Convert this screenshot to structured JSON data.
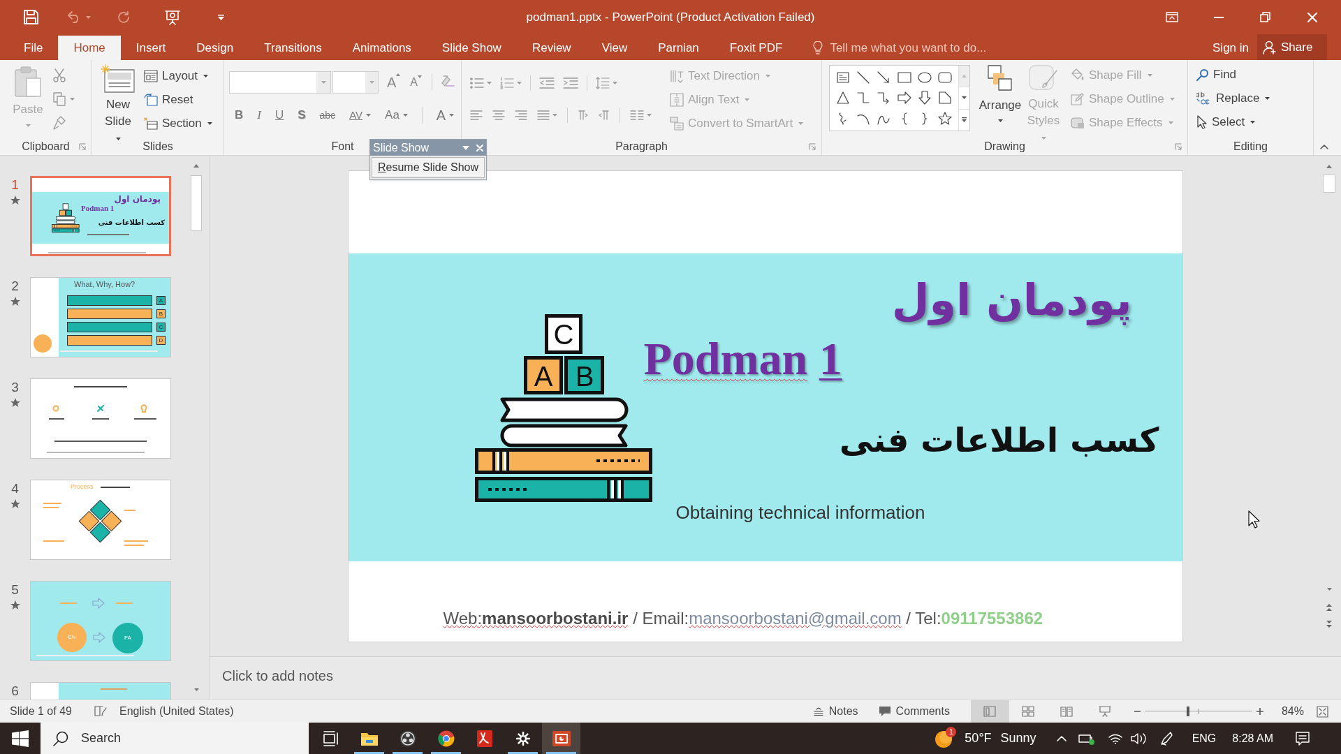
{
  "title_bar": {
    "title": "podman1.pptx - PowerPoint (Product Activation Failed)"
  },
  "ribbon_tabs": [
    {
      "label": "File",
      "selected": false
    },
    {
      "label": "Home",
      "selected": true
    },
    {
      "label": "Insert",
      "selected": false
    },
    {
      "label": "Design",
      "selected": false
    },
    {
      "label": "Transitions",
      "selected": false
    },
    {
      "label": "Animations",
      "selected": false
    },
    {
      "label": "Slide Show",
      "selected": false
    },
    {
      "label": "Review",
      "selected": false
    },
    {
      "label": "View",
      "selected": false
    },
    {
      "label": "Parnian",
      "selected": false
    },
    {
      "label": "Foxit PDF",
      "selected": false
    }
  ],
  "tell_me": {
    "placeholder": "Tell me what you want to do..."
  },
  "account": {
    "sign_in": "Sign in",
    "share": "Share"
  },
  "ribbon": {
    "clipboard": {
      "label": "Clipboard",
      "paste": {
        "label": "Paste",
        "disabled": true
      }
    },
    "slides": {
      "label": "Slides",
      "new_slide": {
        "label": "New Slide",
        "disabled": false
      },
      "commands": [
        {
          "label": "Layout",
          "dropdown": true,
          "disabled": false
        },
        {
          "label": "Reset",
          "dropdown": false,
          "disabled": false
        },
        {
          "label": "Section",
          "dropdown": true,
          "disabled": false
        }
      ]
    },
    "font": {
      "label": "Font",
      "size_buttons": [
        {
          "label": "A",
          "kind": "grow"
        },
        {
          "label": "A",
          "kind": "shrink"
        }
      ],
      "format_buttons": [
        {
          "label": "B",
          "kind": "bold"
        },
        {
          "label": "I",
          "kind": "italic"
        },
        {
          "label": "U",
          "kind": "underline"
        },
        {
          "label": "S",
          "kind": "shadow"
        },
        {
          "label": "abc",
          "kind": "strike"
        },
        {
          "label": "AV",
          "kind": "spacing"
        },
        {
          "label": "Aa",
          "kind": "case"
        },
        {
          "label": "A",
          "kind": "color"
        }
      ]
    },
    "paragraph": {
      "label": "Paragraph",
      "commands": [
        {
          "label": "Text Direction",
          "dropdown": true,
          "disabled": true
        },
        {
          "label": "Align Text",
          "dropdown": true,
          "disabled": true
        },
        {
          "label": "Convert to SmartArt",
          "dropdown": true,
          "disabled": true
        }
      ]
    },
    "drawing": {
      "label": "Drawing",
      "arrange": {
        "label": "Arrange",
        "disabled": false
      },
      "quick_styles": {
        "label": "Quick Styles",
        "disabled": true
      },
      "commands": [
        {
          "label": "Shape Fill",
          "dropdown": true,
          "disabled": true
        },
        {
          "label": "Shape Outline",
          "dropdown": true,
          "disabled": true
        },
        {
          "label": "Shape Effects",
          "dropdown": true,
          "disabled": true
        }
      ]
    },
    "editing": {
      "label": "Editing",
      "commands": [
        {
          "label": "Find",
          "dropdown": false,
          "disabled": false
        },
        {
          "label": "Replace",
          "dropdown": true,
          "disabled": false
        },
        {
          "label": "Select",
          "dropdown": true,
          "disabled": false
        }
      ]
    }
  },
  "slideshow_toolbar": {
    "title": "Slide Show",
    "button": "Resume Slide Show"
  },
  "slide_thumbnails": [
    {
      "number": "1",
      "selected": true,
      "kind": "title",
      "texts": [
        "پودمان اول",
        "Podman 1",
        "کسب اطلاعات فنی"
      ]
    },
    {
      "number": "2",
      "selected": false,
      "kind": "questions",
      "texts": [
        "What, Why, How?",
        "A",
        "B",
        "C",
        "D"
      ]
    },
    {
      "number": "3",
      "selected": false,
      "kind": "icons"
    },
    {
      "number": "4",
      "selected": false,
      "kind": "process",
      "texts": [
        "Process"
      ]
    },
    {
      "number": "5",
      "selected": false,
      "kind": "languages",
      "texts": [
        "EN",
        "FA"
      ]
    },
    {
      "number": "6",
      "selected": false,
      "kind": "partial"
    }
  ],
  "slide": {
    "title_fa": "پودمان اول",
    "title_en": "Podman",
    "title_number": "1",
    "subtitle_fa": "کسب اطلاعات فنی",
    "subtitle_en": "Obtaining technical information",
    "blocks": [
      "C",
      "A",
      "B"
    ],
    "footer": {
      "web_label": "Web:",
      "web": "mansoorbostani.ir",
      "email_label": "/ Email:",
      "email": "mansoorbostani@gmail.com",
      "tel_label": "/ Tel:",
      "tel": "09117553862"
    }
  },
  "notes": {
    "placeholder": "Click to add notes"
  },
  "status_bar": {
    "slide_counter": "Slide 1 of 49",
    "language": "English (United States)",
    "notes": "Notes",
    "comments": "Comments",
    "views": [
      {
        "kind": "normal",
        "selected": true
      },
      {
        "kind": "sorter",
        "selected": false
      },
      {
        "kind": "reading",
        "selected": false
      },
      {
        "kind": "slideshow",
        "selected": false
      }
    ],
    "zoom": {
      "level": 0.4,
      "reading": "84%"
    }
  },
  "taskbar": {
    "search": {
      "placeholder": "Search"
    },
    "apps": [
      {
        "kind": "task_view",
        "running": false,
        "active": false
      },
      {
        "kind": "explorer",
        "running": true,
        "active": false
      },
      {
        "kind": "recorder",
        "running": true,
        "active": false
      },
      {
        "kind": "browser",
        "running": true,
        "active": false
      },
      {
        "kind": "pdf",
        "running": false,
        "active": false
      },
      {
        "kind": "settings",
        "running": true,
        "active": false
      },
      {
        "kind": "powerpoint",
        "running": true,
        "active": true
      }
    ],
    "weather": {
      "badge": "1",
      "temperature": "50°F",
      "condition": "Sunny"
    },
    "language": "ENG",
    "time": "8:28 AM"
  }
}
